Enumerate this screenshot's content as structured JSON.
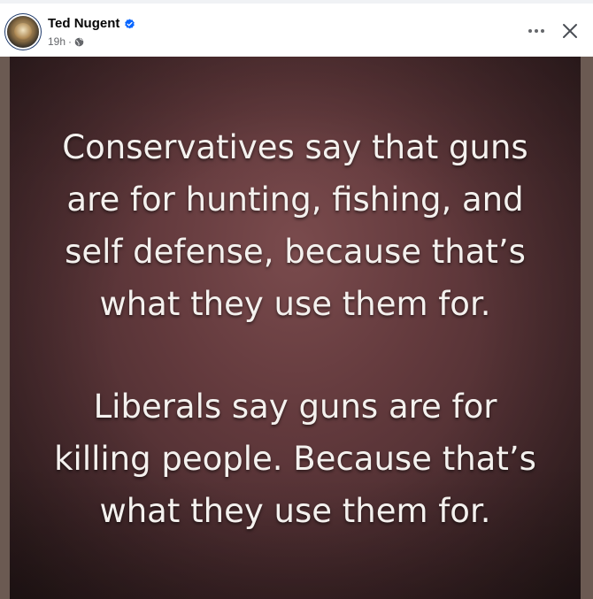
{
  "post": {
    "author": "Ted Nugent",
    "timestamp": "19h",
    "separator": "·",
    "privacy_icon": "globe-icon",
    "verified_icon": "verified-badge-icon",
    "more_icon": "more-options-icon",
    "close_icon": "close-icon"
  },
  "image": {
    "paragraph_1": [
      "Conservatives say that guns",
      "are for hunting, fishing, and",
      "self defense, because that’s",
      "what they use them for."
    ],
    "paragraph_2": [
      "Liberals say guns are for",
      "killing people. Because that’s",
      "what they use them for."
    ]
  },
  "colors": {
    "verified": "#0866ff",
    "secondary_text": "#65676b",
    "primary_text": "#050505"
  }
}
